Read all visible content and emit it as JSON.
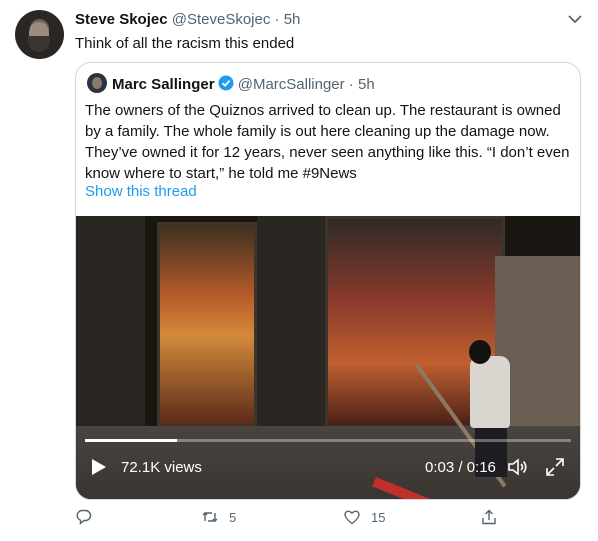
{
  "tweet": {
    "author_name": "Steve Skojec",
    "author_handle": "@SteveSkojec",
    "separator": "·",
    "time": "5h",
    "text": "Think of all the racism this ended",
    "menu_icon": "chevron-down-icon"
  },
  "quoted_tweet": {
    "author_name": "Marc Sallinger",
    "verified": true,
    "author_handle": "@MarcSallinger",
    "separator": "·",
    "time": "5h",
    "text": "The owners of the Quiznos arrived to clean up. The restaurant is owned by a family. The whole family is out here cleaning up the damage now. They’ve owned it for 12 years, never seen anything like this. “I don’t even know where to start,” he told me #9News",
    "show_thread": "Show this thread",
    "video": {
      "views": "72.1K views",
      "timecode": "0:03 / 0:16",
      "progress": 0.19
    }
  },
  "actions": {
    "reply_icon": "reply-icon",
    "retweet_icon": "retweet-icon",
    "retweet_count": "5",
    "like_icon": "heart-icon",
    "like_count": "15",
    "share_icon": "share-icon"
  },
  "colors": {
    "link": "#1d9bf0",
    "secondary_text": "#536471",
    "border": "#cfd9de"
  }
}
